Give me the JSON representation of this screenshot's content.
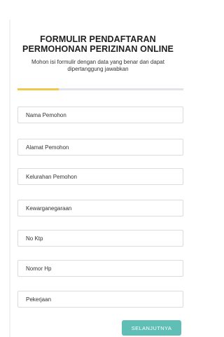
{
  "form": {
    "title_line1": "FORMULIR PENDAFTARAN",
    "title_line2": "PERMOHONAN PERIZINAN ONLINE",
    "subtitle_line1": "Mohon isi formulir dengan data yang benar dan dapat",
    "subtitle_line2": "dipertanggung jawabkan",
    "progress": 0.25,
    "colors": {
      "progress_fill": "#f0c94a",
      "progress_track": "#e2e4ea",
      "button": "#5fbfb6"
    },
    "fields": [
      {
        "placeholder": "Nama Pemohon",
        "value": ""
      },
      {
        "placeholder": "Alamat Pemohon",
        "value": ""
      },
      {
        "placeholder": "Kelurahan Pemohon",
        "value": ""
      },
      {
        "placeholder": "Kewarganegaraan",
        "value": ""
      },
      {
        "placeholder": "No Ktp",
        "value": ""
      },
      {
        "placeholder": "Nomor Hp",
        "value": ""
      },
      {
        "placeholder": "Pekerjaan",
        "value": ""
      }
    ],
    "next_label": "SELANJUTNYA"
  }
}
